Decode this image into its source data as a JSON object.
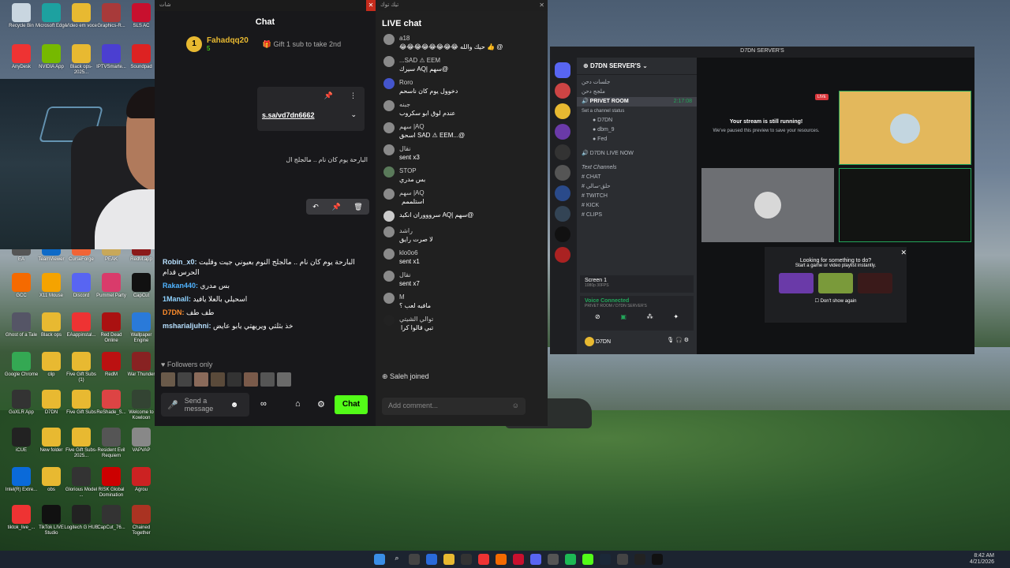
{
  "desktop_icons": [
    {
      "label": "Recycle Bin",
      "color": "#c9d6e0"
    },
    {
      "label": "Microsoft Edge",
      "color": "#1da1a0"
    },
    {
      "label": "Vídeo em voce",
      "color": "#e8b931"
    },
    {
      "label": "Graphics-R...",
      "color": "#a83a3a"
    },
    {
      "label": "SLS AC",
      "color": "#c8102e"
    },
    {
      "label": "AnyDesk",
      "color": "#e33"
    },
    {
      "label": "NVIDIA App",
      "color": "#76b900"
    },
    {
      "label": "Black ops-2025...",
      "color": "#e8b931"
    },
    {
      "label": "IPTVSmarte...",
      "color": "#4b3fd1"
    },
    {
      "label": "Soundpad",
      "color": "#d22"
    },
    {
      "label": "EA",
      "color": "#555"
    },
    {
      "label": "TeamViewer",
      "color": "#0e6ac7"
    },
    {
      "label": "CurseForge",
      "color": "#f16436"
    },
    {
      "label": "PEAK",
      "color": "#c8a85a"
    },
    {
      "label": "RedM.app",
      "color": "#8b1a1a"
    },
    {
      "label": "GCC",
      "color": "#f56a00"
    },
    {
      "label": "X11 Mouse",
      "color": "#f5a300"
    },
    {
      "label": "Discord",
      "color": "#5865f2"
    },
    {
      "label": "Pummel Party",
      "color": "#d93b6b"
    },
    {
      "label": "CapCut",
      "color": "#111"
    },
    {
      "label": "Ghost of a Tale",
      "color": "#556"
    },
    {
      "label": "Black ops",
      "color": "#e8b931"
    },
    {
      "label": "EAappinstal...",
      "color": "#e33"
    },
    {
      "label": "Red Dead Online",
      "color": "#a11"
    },
    {
      "label": "Wallpaper Engine",
      "color": "#2a7ad9"
    },
    {
      "label": "Google Chrome",
      "color": "#34a853"
    },
    {
      "label": "clip",
      "color": "#e8b931"
    },
    {
      "label": "Five Gift Subs (1)",
      "color": "#e8b931"
    },
    {
      "label": "RedM",
      "color": "#b11"
    },
    {
      "label": "War Thunder",
      "color": "#822"
    },
    {
      "label": "GoXLR App",
      "color": "#333"
    },
    {
      "label": "D7DN",
      "color": "#e8b931"
    },
    {
      "label": "Five Gift Subs",
      "color": "#e8b931"
    },
    {
      "label": "ReShade_S...",
      "color": "#d44"
    },
    {
      "label": "Welcome to Kowloon",
      "color": "#343"
    },
    {
      "label": "iCUE",
      "color": "#222"
    },
    {
      "label": "New folder",
      "color": "#e8b931"
    },
    {
      "label": "Five Gift Subs-2025...",
      "color": "#e8b931"
    },
    {
      "label": "Resident Evil Requiem",
      "color": "#555"
    },
    {
      "label": "VAPVAP",
      "color": "#888"
    },
    {
      "label": "Intel(R) Extre...",
      "color": "#0a6ad9"
    },
    {
      "label": "obs",
      "color": "#e8b931"
    },
    {
      "label": "Glorious Model ...",
      "color": "#333"
    },
    {
      "label": "RISK Global Domination",
      "color": "#c00"
    },
    {
      "label": "Agrou",
      "color": "#c22"
    },
    {
      "label": "tiktok_live_...",
      "color": "#e33"
    },
    {
      "label": "TikTok LIVE Studio",
      "color": "#111"
    },
    {
      "label": "Logitech G HUB",
      "color": "#222"
    },
    {
      "label": "CapCut_76...",
      "color": "#333"
    },
    {
      "label": "Chained Together",
      "color": "#a32"
    }
  ],
  "chat": {
    "window_title": "شات",
    "header": "Chat",
    "pinned_user": "Fahadqq20",
    "pinned_rank": "1",
    "pinned_count": "5",
    "pinned_offer": "Gift 1 sub to take 2nd",
    "pinned_link": "s.sa/vd7dn6662",
    "pinned_text": "البارحة يوم كان نام .. مالجلج ال",
    "messages": [
      {
        "user": "Robin_x0",
        "text": "البارحة يوم كان نام .. مالجلج النوم بعيوني جيت وقليت الحرس قدام",
        "color": "#b7e0ff"
      },
      {
        "user": "Rakan440",
        "text": "بس مدري",
        "color": "#4fb3ff"
      },
      {
        "user": "1Manall",
        "text": "اسحيلي بالعلا يافيد",
        "color": "#8fd3ff"
      },
      {
        "user": "D7DN",
        "text": "طف طف",
        "color": "#ff8d2c"
      },
      {
        "user": "msharialjuhni",
        "text": "خذ بثلتي ويريهتي يابو عايض",
        "color": "#b7e0ff"
      }
    ],
    "followers_only": "Followers only",
    "input_placeholder": "Send a message",
    "send_button": "Chat"
  },
  "live": {
    "window_title": "تيك توك",
    "header": "LIVE chat",
    "messages": [
      {
        "user": "a18",
        "text": "@ 👍 حيك والله 😂😂😂😂😂😂😂😂",
        "color": "#8a8a8a"
      },
      {
        "user": "...SAD ⚠ EEM",
        "text": "@سهم |AQ سيرك",
        "color": "#8a8a8a"
      },
      {
        "user": "Roro",
        "text": "دخوول يوم كان ناسحم",
        "color": "#4455cc"
      },
      {
        "user": "جبنه",
        "text": "عندم لوق ابو سكروب",
        "color": "#8a8a8a"
      },
      {
        "user": "سهم |AQ",
        "text": "@...SAD ⚠ EEM اسحق",
        "color": "#8a8a8a"
      },
      {
        "user": "نقال",
        "text": "sent x3",
        "color": "#8a8a8a"
      },
      {
        "user": "STOP",
        "text": "بس مدري",
        "color": "#5a7a5a"
      },
      {
        "user": "سهم |AQ",
        "text": "استلممم",
        "color": "#8a8a8a"
      },
      {
        "user": "",
        "text": "@سهم |AQ سروووران انكيد",
        "color": "#cccccc"
      },
      {
        "user": "راشد",
        "text": "لا صرت رايق",
        "color": "#8a8a8a"
      },
      {
        "user": "klo0o6",
        "text": "sent x1",
        "color": "#8a8a8a"
      },
      {
        "user": "نقال",
        "text": "sent x7",
        "color": "#8a8a8a"
      },
      {
        "user": "M",
        "text": "مافيه لعب ؟",
        "color": "#8a8a8a"
      },
      {
        "user": "توالي الشيتي",
        "text": "تبي قالوا كرا",
        "color": "#222222"
      }
    ],
    "joined": "Saleh joined",
    "input_placeholder": "Add comment..."
  },
  "discord": {
    "title": "D7DN SERVER'S",
    "server_name": "D7DN SERVER'S",
    "voice_category": "جلسات دحن",
    "voice_sub": "ملجج دحن",
    "privet_room": "PRIVET ROOM",
    "privet_time": "2:17:08",
    "privet_status": "Set a channel status",
    "members": [
      "D7DN",
      "dbm_9",
      "Fed"
    ],
    "live_now": "D7DN LIVE NOW",
    "text_category": "Text Channels",
    "text_channels": [
      "CHAT",
      "حلق-سالي",
      "TWITCH",
      "KICK",
      "CLIPS"
    ],
    "screen_label": "Screen 1",
    "screen_meta": "1080p 30FPS",
    "voice_connected": "Voice Connected",
    "voice_where": "PRIVET ROOM / D7DN SERVER'S",
    "user": "D7DN",
    "user_status": "D7DN",
    "stream_running": "Your stream is still running!",
    "stream_paused": "We've paused this preview to save your resources.",
    "live_badge": "LIVE",
    "suggest_title": "Looking for something to do?",
    "suggest_sub": "Start a game or video playlist instantly.",
    "dont_show": "Don't show again"
  },
  "taskbar": {
    "time": "8:42 AM",
    "date": "4/21/2026"
  }
}
